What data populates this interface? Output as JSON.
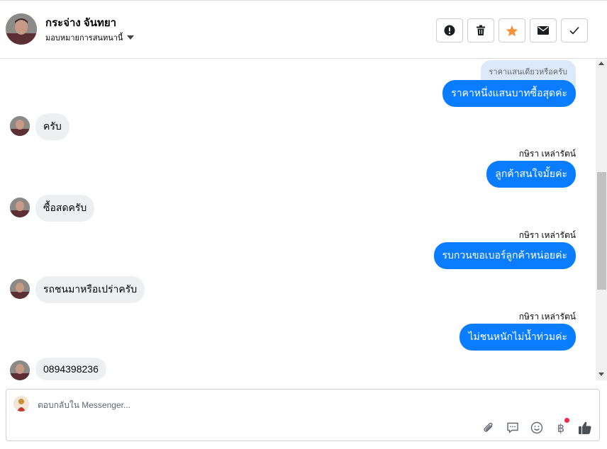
{
  "header": {
    "contact_name": "กระจ่าง จันทยา",
    "assign_label": "มอบหมายการสนทนานี้",
    "actions": [
      {
        "name": "spam-button",
        "icon": "exclamation-icon"
      },
      {
        "name": "delete-button",
        "icon": "trash-icon"
      },
      {
        "name": "star-button",
        "icon": "star-icon",
        "color": "#f7923b"
      },
      {
        "name": "mark-unread-button",
        "icon": "envelope-icon"
      },
      {
        "name": "mark-done-button",
        "icon": "check-icon"
      }
    ]
  },
  "messages": {
    "quoted_reply": "ราคาแสนเดียวหรือครับ",
    "out_1": "ราคาหนึ่งแสนบาทซื้อสุดค่ะ",
    "in_1": "ครับ",
    "sender_1": "กษิรา เหล่ารัตน์",
    "out_2": "ลูกค้าสนใจมั้ยค่ะ",
    "in_2": "ซื้อสดครับ",
    "sender_2": "กษิรา เหล่ารัตน์",
    "out_3": "รบกวนขอเบอร์ลูกค้าหน่อยค่ะ",
    "in_3": "รถชนมาหรือเปร่าครับ",
    "sender_3": "กษิรา เหล่ารัตน์",
    "out_4": "ไม่ชนหนักไม่น้ำท่วมค่ะ",
    "in_4": "0894398236"
  },
  "composer": {
    "placeholder": "ตอบกลับใน Messenger...",
    "value": "",
    "tools": [
      "paperclip-icon",
      "saved-reply-icon",
      "emoji-icon",
      "baht-payment-icon",
      "thumbs-up-icon"
    ],
    "baht_symbol": "฿"
  },
  "colors": {
    "outgoing_bubble": "#0a7cff",
    "incoming_bubble": "#eeeff1",
    "quote_bubble": "#dbe9fb",
    "accent_star": "#f7923b",
    "notification_dot": "#f02849"
  }
}
